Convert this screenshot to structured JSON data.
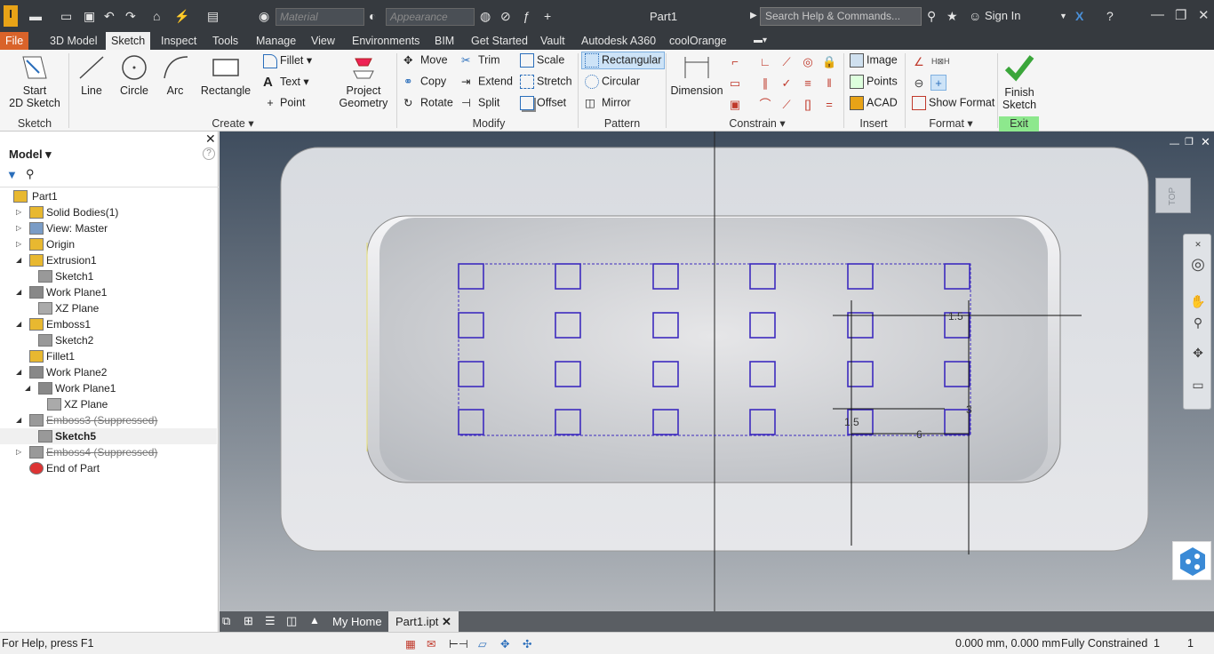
{
  "title_bar": {
    "doc_title": "Part1",
    "material_placeholder": "Material",
    "appearance_placeholder": "Appearance",
    "search_placeholder": "Search Help & Commands...",
    "sign_in": "Sign In",
    "logo_text": "I"
  },
  "menu": {
    "tabs": [
      "File",
      "3D Model",
      "Sketch",
      "Inspect",
      "Tools",
      "Manage",
      "View",
      "Environments",
      "BIM",
      "Get Started",
      "Vault",
      "Autodesk A360",
      "coolOrange"
    ],
    "active": "Sketch"
  },
  "ribbon": {
    "sketch_group": {
      "start": "Start",
      "start2": "2D Sketch",
      "label": "Sketch"
    },
    "create_group": {
      "line": "Line",
      "circle": "Circle",
      "arc": "Arc",
      "rectangle": "Rectangle",
      "fillet": "Fillet",
      "text": "Text",
      "point": "Point",
      "project1": "Project",
      "project2": "Geometry",
      "label": "Create"
    },
    "modify_group": {
      "move": "Move",
      "trim": "Trim",
      "scale": "Scale",
      "copy": "Copy",
      "extend": "Extend",
      "stretch": "Stretch",
      "rotate": "Rotate",
      "split": "Split",
      "offset": "Offset",
      "label": "Modify"
    },
    "pattern_group": {
      "rectangular": "Rectangular",
      "circular": "Circular",
      "mirror": "Mirror",
      "label": "Pattern"
    },
    "constrain_group": {
      "dimension": "Dimension",
      "label": "Constrain"
    },
    "insert_group": {
      "image": "Image",
      "points": "Points",
      "acad": "ACAD",
      "label": "Insert"
    },
    "format_group": {
      "show_format": "Show Format",
      "label": "Format"
    },
    "exit_group": {
      "finish1": "Finish",
      "finish2": "Sketch",
      "label": "Exit"
    }
  },
  "browser": {
    "title": "Model",
    "items": [
      {
        "label": "Part1",
        "indent": 0,
        "exp": ""
      },
      {
        "label": "Solid Bodies(1)",
        "indent": 1,
        "exp": "▷"
      },
      {
        "label": "View: Master",
        "indent": 1,
        "exp": "▷"
      },
      {
        "label": "Origin",
        "indent": 1,
        "exp": "▷"
      },
      {
        "label": "Extrusion1",
        "indent": 1,
        "exp": "◢"
      },
      {
        "label": "Sketch1",
        "indent": 2,
        "exp": ""
      },
      {
        "label": "Work Plane1",
        "indent": 1,
        "exp": "◢"
      },
      {
        "label": "XZ Plane",
        "indent": 2,
        "exp": ""
      },
      {
        "label": "Emboss1",
        "indent": 1,
        "exp": "◢"
      },
      {
        "label": "Sketch2",
        "indent": 2,
        "exp": ""
      },
      {
        "label": "Fillet1",
        "indent": 1,
        "exp": ""
      },
      {
        "label": "Work Plane2",
        "indent": 1,
        "exp": "◢"
      },
      {
        "label": "Work Plane1",
        "indent": 2,
        "exp": "◢"
      },
      {
        "label": "XZ Plane",
        "indent": 3,
        "exp": ""
      },
      {
        "label": "Emboss3 (Suppressed)",
        "indent": 1,
        "exp": "◢",
        "suppressed": true
      },
      {
        "label": "Sketch5",
        "indent": 2,
        "exp": "",
        "bold": true
      },
      {
        "label": "Emboss4 (Suppressed)",
        "indent": 1,
        "exp": "▷",
        "suppressed": true
      },
      {
        "label": "End of Part",
        "indent": 1,
        "exp": ""
      }
    ]
  },
  "viewport": {
    "viewcube": "TOP",
    "dims": {
      "d1": "1.5",
      "d2": "1.5",
      "d3": "6",
      "d4": "3"
    }
  },
  "view_tabs": {
    "home": "My Home",
    "part": "Part1.ipt"
  },
  "status": {
    "help": "For Help, press F1",
    "coords": "0.000 mm, 0.000 mm",
    "constraint": "Fully Constrained",
    "n1": "1",
    "n2": "1"
  }
}
